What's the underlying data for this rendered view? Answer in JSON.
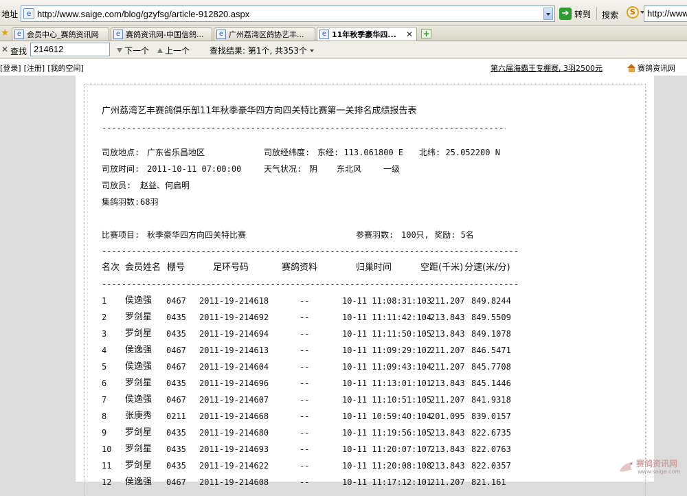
{
  "address_bar": {
    "label": "地址",
    "url": "http://www.saige.com/blog/gzyfsg/article-912820.aspx",
    "go_label": "转到",
    "search_label": "搜索",
    "search_value": "http://www."
  },
  "tabs": [
    {
      "label": "会员中心_赛鸽资讯网",
      "active": false
    },
    {
      "label": "赛鸽资讯网-中国信鸽...",
      "active": false
    },
    {
      "label": "广州荔湾区鸽协艺丰...",
      "active": false
    },
    {
      "label": "11年秋季豪华四...",
      "active": true
    }
  ],
  "find_bar": {
    "label": "查找",
    "value": "214612",
    "next_label": "下一个",
    "prev_label": "上一个",
    "result_text": "查找结果: 第1个, 共353个"
  },
  "page_header": {
    "login": "[登录]",
    "register": "[注册]",
    "my_space": "[我的空间]",
    "promo": "第六届海霸王专棚赛, 3羽2500元",
    "home": "赛鸽资讯网"
  },
  "report": {
    "title": "广州荔湾艺丰赛鸽俱乐部11年秋季豪华四方向四关特比赛第一关排名成绩报告表",
    "release_place_label": "司放地点:",
    "release_place": "广东省乐昌地区",
    "coords_label": "司放经纬度:",
    "longitude": "东经: 113.061800 E",
    "latitude": "北纬: 25.052200 N",
    "release_time_label": "司放时间:",
    "release_time": "2011-10-11 07:00:00",
    "weather_label": "天气状况:",
    "weather": "阴",
    "wind": "东北风",
    "wind_level": "一级",
    "releaser_label": "司放员:",
    "releaser": "赵益、何启明",
    "count_label": "集鸽羽数:",
    "count": "68羽",
    "event_label": "比赛项目:",
    "event": "秋季豪华四方向四关特比赛",
    "entries_label": "参赛羽数:",
    "entries": "100只, 奖励: 5名",
    "columns": [
      "名次",
      "会员姓名",
      "棚号",
      "足环号码",
      "赛鸽资料",
      "归巢时间",
      "空距(千米)",
      "分速(米/分)"
    ],
    "rows": [
      {
        "rank": "1",
        "name": "侯逸强",
        "loft": "0467",
        "ring": "2011-19-214618",
        "info": "--",
        "time": "10-11 11:08:31:103",
        "dist": "211.207",
        "speed": "849.8244"
      },
      {
        "rank": "2",
        "name": "罗剑星",
        "loft": "0435",
        "ring": "2011-19-214692",
        "info": "--",
        "time": "10-11 11:11:42:104",
        "dist": "213.843",
        "speed": "849.5509"
      },
      {
        "rank": "3",
        "name": "罗剑星",
        "loft": "0435",
        "ring": "2011-19-214694",
        "info": "--",
        "time": "10-11 11:11:50:105",
        "dist": "213.843",
        "speed": "849.1078"
      },
      {
        "rank": "4",
        "name": "侯逸强",
        "loft": "0467",
        "ring": "2011-19-214613",
        "info": "--",
        "time": "10-11 11:09:29:102",
        "dist": "211.207",
        "speed": "846.5471"
      },
      {
        "rank": "5",
        "name": "侯逸强",
        "loft": "0467",
        "ring": "2011-19-214604",
        "info": "--",
        "time": "10-11 11:09:43:104",
        "dist": "211.207",
        "speed": "845.7708"
      },
      {
        "rank": "6",
        "name": "罗剑星",
        "loft": "0435",
        "ring": "2011-19-214696",
        "info": "--",
        "time": "10-11 11:13:01:101",
        "dist": "213.843",
        "speed": "845.1446"
      },
      {
        "rank": "7",
        "name": "侯逸强",
        "loft": "0467",
        "ring": "2011-19-214607",
        "info": "--",
        "time": "10-11 11:10:51:105",
        "dist": "211.207",
        "speed": "841.9318"
      },
      {
        "rank": "8",
        "name": "张庚秀",
        "loft": "0211",
        "ring": "2011-19-214668",
        "info": "--",
        "time": "10-11 10:59:40:104",
        "dist": "201.095",
        "speed": "839.0157"
      },
      {
        "rank": "9",
        "name": "罗剑星",
        "loft": "0435",
        "ring": "2011-19-214680",
        "info": "--",
        "time": "10-11 11:19:56:105",
        "dist": "213.843",
        "speed": "822.6735"
      },
      {
        "rank": "10",
        "name": "罗剑星",
        "loft": "0435",
        "ring": "2011-19-214693",
        "info": "--",
        "time": "10-11 11:20:07:107",
        "dist": "213.843",
        "speed": "822.0763"
      },
      {
        "rank": "11",
        "name": "罗剑星",
        "loft": "0435",
        "ring": "2011-19-214622",
        "info": "--",
        "time": "10-11 11:20:08:108",
        "dist": "213.843",
        "speed": "822.0357"
      },
      {
        "rank": "12",
        "name": "侯逸强",
        "loft": "0467",
        "ring": "2011-19-214608",
        "info": "--",
        "time": "10-11 11:17:12:101",
        "dist": "211.207",
        "speed": "821.161"
      }
    ]
  },
  "watermark": {
    "name": "赛鸽资讯网",
    "url": "www.saige.com"
  }
}
